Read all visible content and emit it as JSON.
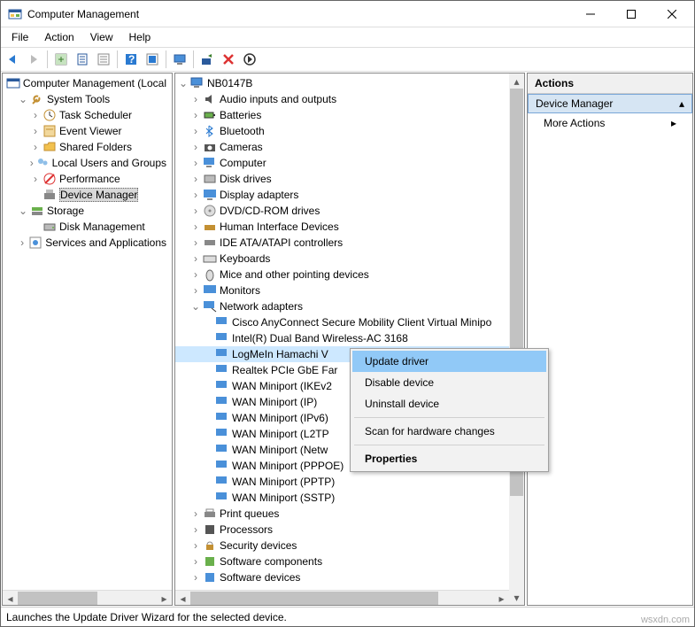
{
  "window": {
    "title": "Computer Management"
  },
  "menu": {
    "file": "File",
    "action": "Action",
    "view": "View",
    "help": "Help"
  },
  "left_tree": {
    "root": "Computer Management (Local",
    "systools": "System Tools",
    "task": "Task Scheduler",
    "event": "Event Viewer",
    "shared": "Shared Folders",
    "users": "Local Users and Groups",
    "perf": "Performance",
    "devmgr": "Device Manager",
    "storage": "Storage",
    "diskmgmt": "Disk Management",
    "services": "Services and Applications"
  },
  "mid_tree": {
    "root": "NB0147B",
    "audio": "Audio inputs and outputs",
    "batt": "Batteries",
    "bt": "Bluetooth",
    "cam": "Cameras",
    "comp": "Computer",
    "disk": "Disk drives",
    "disp": "Display adapters",
    "dvd": "DVD/CD-ROM drives",
    "hid": "Human Interface Devices",
    "ide": "IDE ATA/ATAPI controllers",
    "kb": "Keyboards",
    "mouse": "Mice and other pointing devices",
    "mon": "Monitors",
    "net": "Network adapters",
    "net_cisco": "Cisco AnyConnect Secure Mobility Client Virtual Minipo",
    "net_intel": "Intel(R) Dual Band Wireless-AC 3168",
    "net_hamachi": "LogMeIn Hamachi V",
    "net_realtek": "Realtek PCIe GbE Far",
    "net_wan_ikev2": "WAN Miniport (IKEv2",
    "net_wan_ip": "WAN Miniport (IP)",
    "net_wan_ipv6": "WAN Miniport (IPv6)",
    "net_wan_l2tp": "WAN Miniport (L2TP",
    "net_wan_netw": "WAN Miniport (Netw",
    "net_wan_pppoe": "WAN Miniport (PPPOE)",
    "net_wan_pptp": "WAN Miniport (PPTP)",
    "net_wan_sstp": "WAN Miniport (SSTP)",
    "print": "Print queues",
    "proc": "Processors",
    "secdev": "Security devices",
    "softcomp": "Software components",
    "softdev": "Software devices"
  },
  "ctx": {
    "update": "Update driver",
    "disable": "Disable device",
    "uninstall": "Uninstall device",
    "scan": "Scan for hardware changes",
    "props": "Properties"
  },
  "actions": {
    "header": "Actions",
    "devmgr": "Device Manager",
    "more": "More Actions"
  },
  "status": "Launches the Update Driver Wizard for the selected device.",
  "watermark": "wsxdn.com"
}
